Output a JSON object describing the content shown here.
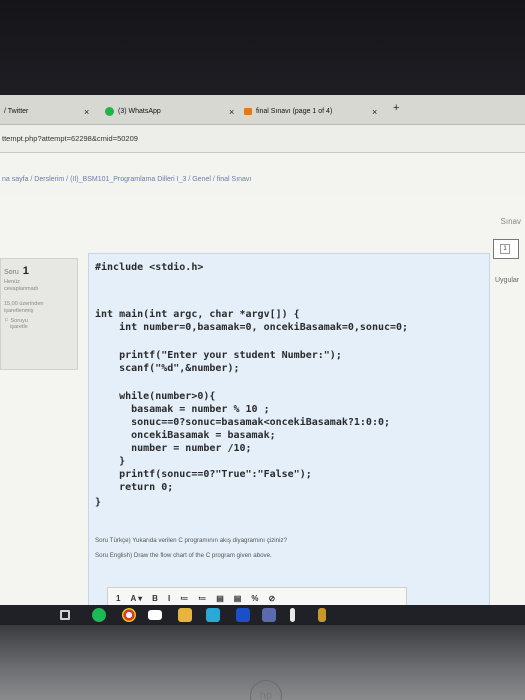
{
  "browser": {
    "tabs": [
      {
        "label": "/ Twitter"
      },
      {
        "label": "(3) WhatsApp"
      },
      {
        "label": "final Sınavı (page 1 of 4)"
      }
    ],
    "new_tab_label": "+",
    "close_label": "×",
    "url": "ttempt.php?attempt=62298&cmid=50209"
  },
  "breadcrumb": "na sayfa  /  Derslerim  /  (II)_BSM101_Programlama Dilleri I_3  /  Genel  /  final Sınavı",
  "sidebar_right": {
    "title": "Sınav",
    "nav_number": "1",
    "apply_label": "Uygular"
  },
  "question_info": {
    "label": "Soru",
    "number": "1",
    "status_line1": "Henüz",
    "status_line2": "cevaplanmadı",
    "points_line1": "15,00 üzerinden",
    "points_line2": "işaretlenmiş",
    "flag_line1": "Soruyu",
    "flag_line2": "işaretle"
  },
  "code_lines": [
    "#include <stdio.h>",
    "",
    "int main(int argc, char *argv[]) {",
    "    int number=0,basamak=0, oncekiBasamak=0,sonuc=0;",
    "",
    "    printf(\"Enter your student Number:\");",
    "    scanf(\"%d\",&number);",
    "",
    "    while(number>0){",
    "      basamak = number % 10 ;",
    "      sonuc==0?sonuc=basamak<oncekiBasamak?1:0:0;",
    "      oncekiBasamak = basamak;",
    "      number = number /10;",
    "    }",
    "    printf(sonuc==0?\"True\":\"False\");",
    "    return 0;",
    "}"
  ],
  "question_tr": "Soru Türkçe) Yukarıda verilen C programının akış diyagramını çiziniz?",
  "question_en": "Soru English) Draw the flow chart of the C program given above.",
  "editor_toolbar": [
    "1",
    "A ▾",
    "B",
    "I",
    "≔",
    "≔",
    "▤",
    "▤",
    "%",
    "⊘"
  ],
  "brand_logo": "hp"
}
